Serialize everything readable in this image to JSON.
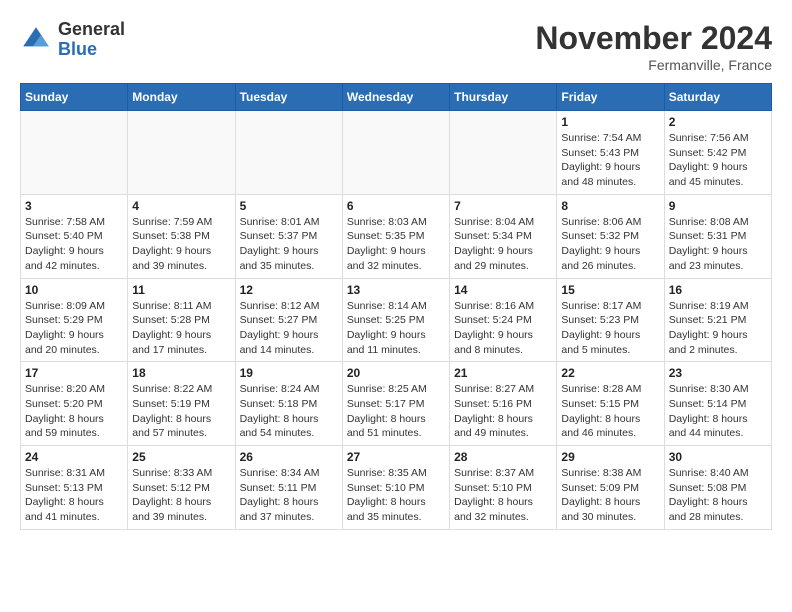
{
  "header": {
    "logo": {
      "general": "General",
      "blue": "Blue"
    },
    "month": "November 2024",
    "location": "Fermanville, France"
  },
  "weekdays": [
    "Sunday",
    "Monday",
    "Tuesday",
    "Wednesday",
    "Thursday",
    "Friday",
    "Saturday"
  ],
  "weeks": [
    [
      {
        "day": "",
        "sunrise": "",
        "sunset": "",
        "daylight": ""
      },
      {
        "day": "",
        "sunrise": "",
        "sunset": "",
        "daylight": ""
      },
      {
        "day": "",
        "sunrise": "",
        "sunset": "",
        "daylight": ""
      },
      {
        "day": "",
        "sunrise": "",
        "sunset": "",
        "daylight": ""
      },
      {
        "day": "",
        "sunrise": "",
        "sunset": "",
        "daylight": ""
      },
      {
        "day": "1",
        "sunrise": "Sunrise: 7:54 AM",
        "sunset": "Sunset: 5:43 PM",
        "daylight": "Daylight: 9 hours and 48 minutes."
      },
      {
        "day": "2",
        "sunrise": "Sunrise: 7:56 AM",
        "sunset": "Sunset: 5:42 PM",
        "daylight": "Daylight: 9 hours and 45 minutes."
      }
    ],
    [
      {
        "day": "3",
        "sunrise": "Sunrise: 7:58 AM",
        "sunset": "Sunset: 5:40 PM",
        "daylight": "Daylight: 9 hours and 42 minutes."
      },
      {
        "day": "4",
        "sunrise": "Sunrise: 7:59 AM",
        "sunset": "Sunset: 5:38 PM",
        "daylight": "Daylight: 9 hours and 39 minutes."
      },
      {
        "day": "5",
        "sunrise": "Sunrise: 8:01 AM",
        "sunset": "Sunset: 5:37 PM",
        "daylight": "Daylight: 9 hours and 35 minutes."
      },
      {
        "day": "6",
        "sunrise": "Sunrise: 8:03 AM",
        "sunset": "Sunset: 5:35 PM",
        "daylight": "Daylight: 9 hours and 32 minutes."
      },
      {
        "day": "7",
        "sunrise": "Sunrise: 8:04 AM",
        "sunset": "Sunset: 5:34 PM",
        "daylight": "Daylight: 9 hours and 29 minutes."
      },
      {
        "day": "8",
        "sunrise": "Sunrise: 8:06 AM",
        "sunset": "Sunset: 5:32 PM",
        "daylight": "Daylight: 9 hours and 26 minutes."
      },
      {
        "day": "9",
        "sunrise": "Sunrise: 8:08 AM",
        "sunset": "Sunset: 5:31 PM",
        "daylight": "Daylight: 9 hours and 23 minutes."
      }
    ],
    [
      {
        "day": "10",
        "sunrise": "Sunrise: 8:09 AM",
        "sunset": "Sunset: 5:29 PM",
        "daylight": "Daylight: 9 hours and 20 minutes."
      },
      {
        "day": "11",
        "sunrise": "Sunrise: 8:11 AM",
        "sunset": "Sunset: 5:28 PM",
        "daylight": "Daylight: 9 hours and 17 minutes."
      },
      {
        "day": "12",
        "sunrise": "Sunrise: 8:12 AM",
        "sunset": "Sunset: 5:27 PM",
        "daylight": "Daylight: 9 hours and 14 minutes."
      },
      {
        "day": "13",
        "sunrise": "Sunrise: 8:14 AM",
        "sunset": "Sunset: 5:25 PM",
        "daylight": "Daylight: 9 hours and 11 minutes."
      },
      {
        "day": "14",
        "sunrise": "Sunrise: 8:16 AM",
        "sunset": "Sunset: 5:24 PM",
        "daylight": "Daylight: 9 hours and 8 minutes."
      },
      {
        "day": "15",
        "sunrise": "Sunrise: 8:17 AM",
        "sunset": "Sunset: 5:23 PM",
        "daylight": "Daylight: 9 hours and 5 minutes."
      },
      {
        "day": "16",
        "sunrise": "Sunrise: 8:19 AM",
        "sunset": "Sunset: 5:21 PM",
        "daylight": "Daylight: 9 hours and 2 minutes."
      }
    ],
    [
      {
        "day": "17",
        "sunrise": "Sunrise: 8:20 AM",
        "sunset": "Sunset: 5:20 PM",
        "daylight": "Daylight: 8 hours and 59 minutes."
      },
      {
        "day": "18",
        "sunrise": "Sunrise: 8:22 AM",
        "sunset": "Sunset: 5:19 PM",
        "daylight": "Daylight: 8 hours and 57 minutes."
      },
      {
        "day": "19",
        "sunrise": "Sunrise: 8:24 AM",
        "sunset": "Sunset: 5:18 PM",
        "daylight": "Daylight: 8 hours and 54 minutes."
      },
      {
        "day": "20",
        "sunrise": "Sunrise: 8:25 AM",
        "sunset": "Sunset: 5:17 PM",
        "daylight": "Daylight: 8 hours and 51 minutes."
      },
      {
        "day": "21",
        "sunrise": "Sunrise: 8:27 AM",
        "sunset": "Sunset: 5:16 PM",
        "daylight": "Daylight: 8 hours and 49 minutes."
      },
      {
        "day": "22",
        "sunrise": "Sunrise: 8:28 AM",
        "sunset": "Sunset: 5:15 PM",
        "daylight": "Daylight: 8 hours and 46 minutes."
      },
      {
        "day": "23",
        "sunrise": "Sunrise: 8:30 AM",
        "sunset": "Sunset: 5:14 PM",
        "daylight": "Daylight: 8 hours and 44 minutes."
      }
    ],
    [
      {
        "day": "24",
        "sunrise": "Sunrise: 8:31 AM",
        "sunset": "Sunset: 5:13 PM",
        "daylight": "Daylight: 8 hours and 41 minutes."
      },
      {
        "day": "25",
        "sunrise": "Sunrise: 8:33 AM",
        "sunset": "Sunset: 5:12 PM",
        "daylight": "Daylight: 8 hours and 39 minutes."
      },
      {
        "day": "26",
        "sunrise": "Sunrise: 8:34 AM",
        "sunset": "Sunset: 5:11 PM",
        "daylight": "Daylight: 8 hours and 37 minutes."
      },
      {
        "day": "27",
        "sunrise": "Sunrise: 8:35 AM",
        "sunset": "Sunset: 5:10 PM",
        "daylight": "Daylight: 8 hours and 35 minutes."
      },
      {
        "day": "28",
        "sunrise": "Sunrise: 8:37 AM",
        "sunset": "Sunset: 5:10 PM",
        "daylight": "Daylight: 8 hours and 32 minutes."
      },
      {
        "day": "29",
        "sunrise": "Sunrise: 8:38 AM",
        "sunset": "Sunset: 5:09 PM",
        "daylight": "Daylight: 8 hours and 30 minutes."
      },
      {
        "day": "30",
        "sunrise": "Sunrise: 8:40 AM",
        "sunset": "Sunset: 5:08 PM",
        "daylight": "Daylight: 8 hours and 28 minutes."
      }
    ]
  ]
}
